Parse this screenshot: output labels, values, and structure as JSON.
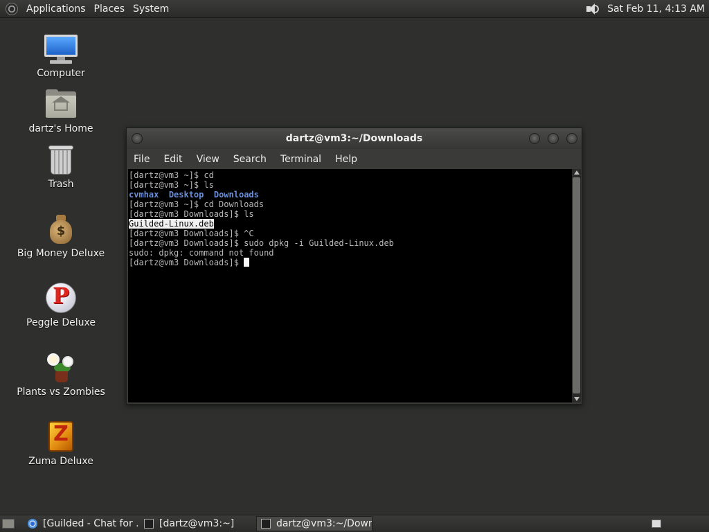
{
  "top_panel": {
    "menus": [
      "Applications",
      "Places",
      "System"
    ],
    "clock": "Sat Feb 11,  4:13 AM"
  },
  "desktop_icons": [
    {
      "label": "Computer",
      "icon": "computer-icon"
    },
    {
      "label": "dartz's Home",
      "icon": "home-folder-icon"
    },
    {
      "label": "Trash",
      "icon": "trash-icon"
    },
    {
      "label": "Big Money Deluxe",
      "icon": "money-bag-icon"
    },
    {
      "label": "Peggle Deluxe",
      "icon": "peggle-icon"
    },
    {
      "label": "Plants vs Zombies",
      "icon": "plants-vs-zombies-icon"
    },
    {
      "label": "Zuma Deluxe",
      "icon": "zuma-icon"
    }
  ],
  "terminal": {
    "title": "dartz@vm3:~/Downloads",
    "menu": [
      "File",
      "Edit",
      "View",
      "Search",
      "Terminal",
      "Help"
    ],
    "lines": {
      "l1": "[dartz@vm3 ~]$ cd",
      "l2": "[dartz@vm3 ~]$ ls",
      "l3_dirs": [
        "cvmhax",
        "Desktop",
        "Downloads"
      ],
      "l4": "[dartz@vm3 ~]$ cd Downloads",
      "l5": "[dartz@vm3 Downloads]$ ls",
      "l6_file": "Guilded-Linux.deb",
      "l7": "[dartz@vm3 Downloads]$ ^C",
      "l8": "[dartz@vm3 Downloads]$ sudo dpkg -i Guilded-Linux.deb",
      "l9": "sudo: dpkg: command not found",
      "l10": "[dartz@vm3 Downloads]$ "
    }
  },
  "taskbar": {
    "tasks": [
      {
        "label": "[Guilded - Chat for ...",
        "icon": "chrome-icon"
      },
      {
        "label": "[dartz@vm3:~]",
        "icon": "terminal-icon"
      },
      {
        "label": "dartz@vm3:~/Down...",
        "icon": "terminal-icon",
        "active": true
      }
    ]
  }
}
